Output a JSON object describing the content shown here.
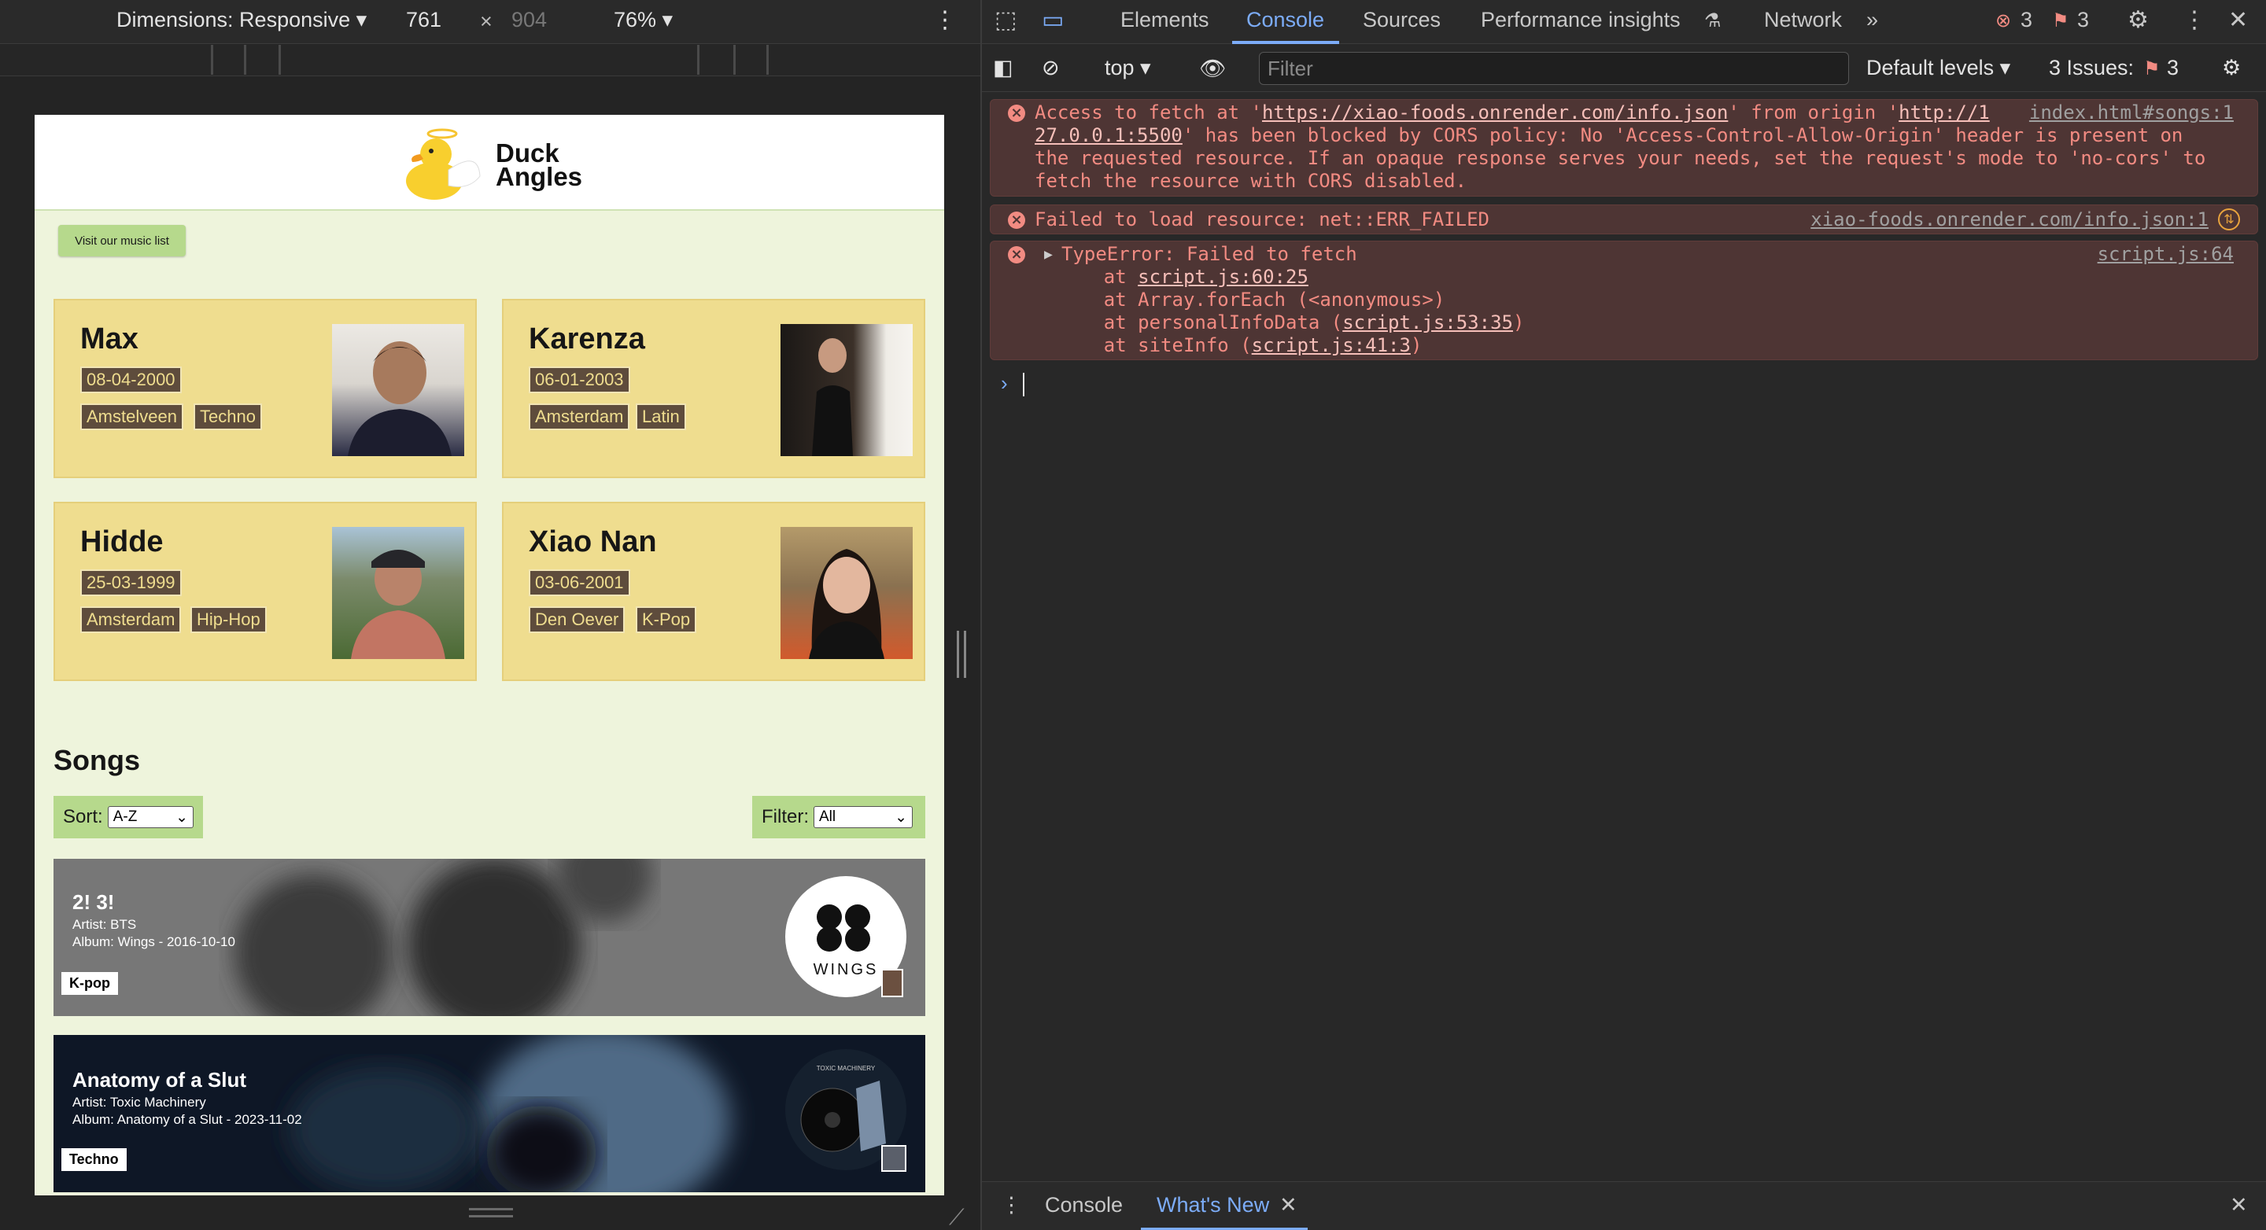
{
  "device_toolbar": {
    "dimensions_label": "Dimensions: Responsive ▾",
    "width": "761",
    "times": "×",
    "height": "904",
    "zoom": "76% ▾",
    "more": "⋮"
  },
  "site": {
    "logo_text_line1": "Duck",
    "logo_text_line2": "Angles",
    "music_button": "Visit our music list",
    "people": [
      {
        "name": "Max",
        "date": "08-04-2000",
        "city": "Amstelveen",
        "genre": "Techno"
      },
      {
        "name": "Karenza",
        "date": "06-01-2003",
        "city": "Amsterdam",
        "genre": "Latin"
      },
      {
        "name": "Hidde",
        "date": "25-03-1999",
        "city": "Amsterdam",
        "genre": "Hip-Hop"
      },
      {
        "name": "Xiao Nan",
        "date": "03-06-2001",
        "city": "Den Oever",
        "genre": "K-Pop"
      }
    ],
    "songs_heading": "Songs",
    "sort_label": "Sort:",
    "sort_value": "A-Z",
    "filter_label": "Filter:",
    "filter_value": "All",
    "songs": [
      {
        "title": "2! 3!",
        "artist": "Artist: BTS",
        "album": "Album: Wings - 2016-10-10",
        "genre": "K-pop",
        "cover_text": "WINGS"
      },
      {
        "title": "Anatomy of a Slut",
        "artist": "Artist: Toxic Machinery",
        "album": "Album: Anatomy of a Slut - 2023-11-02",
        "genre": "Techno",
        "cover_text": "TOXIC MACHINERY"
      }
    ]
  },
  "devtools": {
    "tabs": [
      "Elements",
      "Console",
      "Sources",
      "Performance insights",
      "Network"
    ],
    "more_tabs": "»",
    "error_count": "3",
    "issue_count": "3",
    "console_bar": {
      "context": "top",
      "filter_placeholder": "Filter",
      "levels": "Default levels ▾",
      "issues_label": "3 Issues:",
      "issues_count": "3"
    },
    "messages": [
      {
        "line1_a": "Access to fetch at '",
        "line1_url": "https://xiao-foods.onrender.com/info.json",
        "line1_b": "' from origin '",
        "line1_origin": "http://1",
        "line2_origin": "27.0.0.1:5500",
        "line2_b": "' has been blocked by CORS policy: No 'Access-Control-Allow-Origin' header is present on",
        "line3": "the requested resource. If an opaque response serves your needs, set the request's mode to 'no-cors' to",
        "line4": "fetch the resource with CORS disabled.",
        "source": "index.html#songs:1"
      },
      {
        "text": "Failed to load resource: net::ERR_FAILED",
        "source": "xiao-foods.onrender.com/info.json:1"
      },
      {
        "text": "TypeError: Failed to fetch",
        "stack": [
          {
            "pre": "    at ",
            "link": "script.js:60:25",
            "post": ""
          },
          {
            "pre": "    at Array.forEach (<anonymous>)",
            "link": "",
            "post": ""
          },
          {
            "pre": "    at personalInfoData (",
            "link": "script.js:53:35",
            "post": ")"
          },
          {
            "pre": "    at siteInfo (",
            "link": "script.js:41:3",
            "post": ")"
          }
        ],
        "source": "script.js:64"
      }
    ],
    "prompt": "›",
    "drawer": {
      "console_tab": "Console",
      "whats_new_tab": "What's New"
    }
  }
}
